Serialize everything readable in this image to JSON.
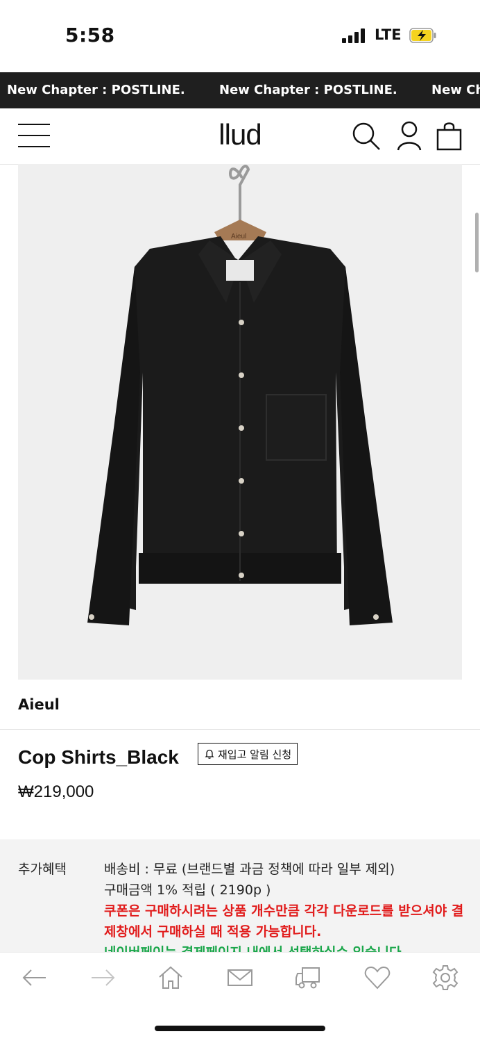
{
  "status": {
    "time": "5:58",
    "network": "LTE"
  },
  "ticker": {
    "items": [
      "New Chapter : POSTLINE.",
      "New Chapter : POSTLINE.",
      "New Ch"
    ]
  },
  "header": {
    "logo": "llud"
  },
  "product": {
    "brand": "Aieul",
    "title": "Cop Shirts_Black",
    "restock_label": "재입고 알림 신청",
    "price": "₩219,000",
    "hanger_tag": "Aieul"
  },
  "benefits": {
    "label": "추가혜택",
    "shipping": "배송비 : 무료 (브랜드별 과금 정책에 따라 일부 제외)",
    "points": "구매금액 1% 적립 ( 2190p )",
    "coupon_notice": "쿠폰은 구매하시려는 상품 개수만큼 각각 다운로드를 받으셔야 결제창에서 구매하실 때 적용 가능합니다.",
    "naverpay_notice": "네이버페이는 결제페이지 내에서 선택하실수 있습니다"
  },
  "colors": {
    "accent_red": "#e11b1b",
    "accent_green": "#1aa64a",
    "ticker_bg": "#1f1f1f",
    "battery_yellow": "#f5d31f"
  },
  "toolbar_icons": [
    "back-arrow-icon",
    "forward-arrow-icon",
    "home-icon",
    "mail-icon",
    "delivery-truck-icon",
    "heart-icon",
    "gear-icon"
  ]
}
